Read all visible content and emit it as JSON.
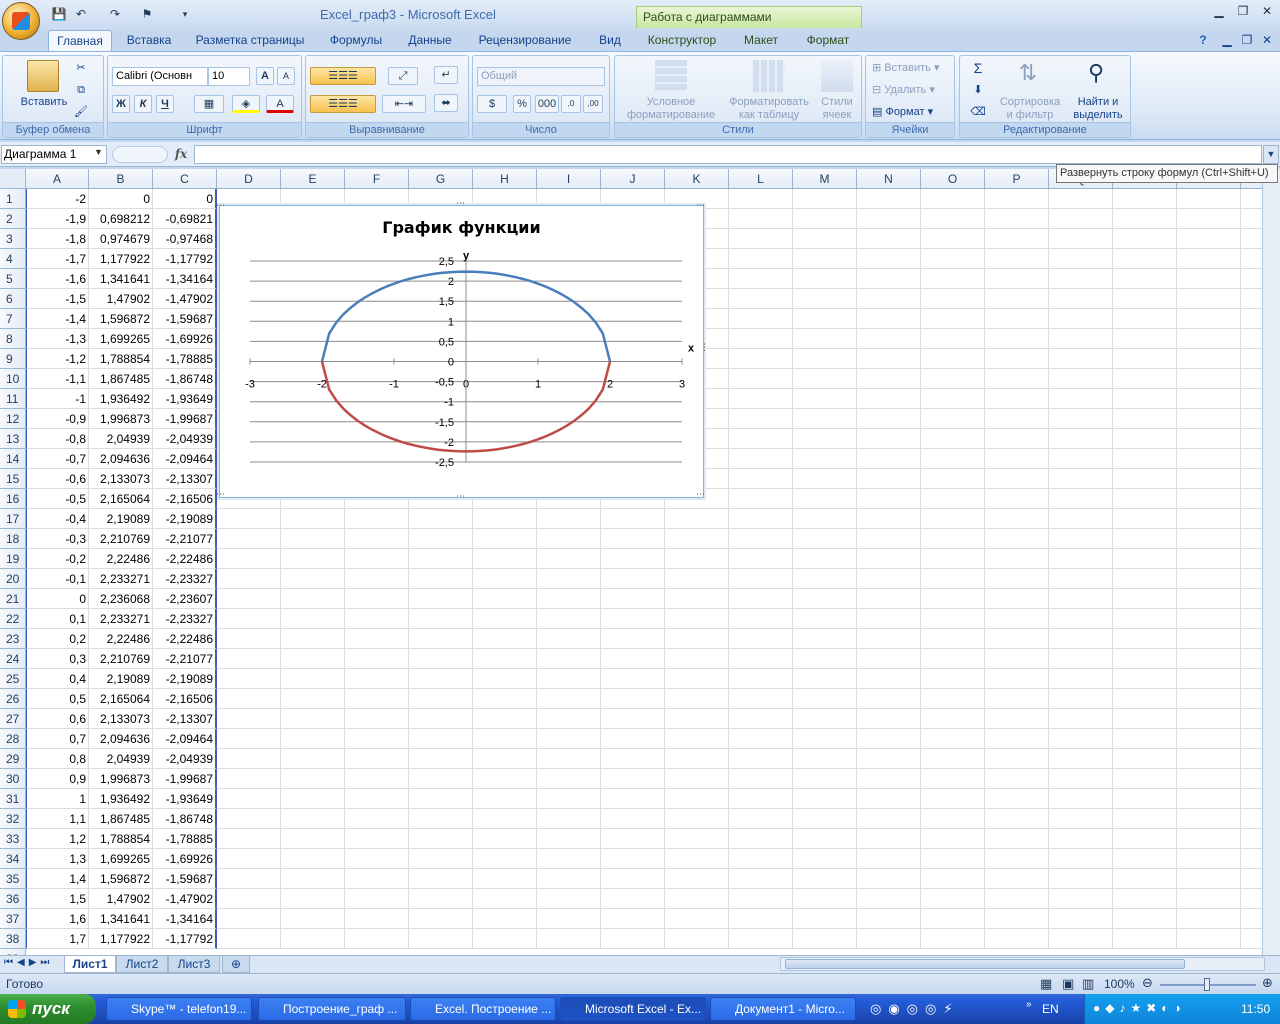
{
  "window": {
    "title": "Excel_граф3 - Microsoft Excel",
    "context_tools": "Работа с диаграммами"
  },
  "tabs": [
    {
      "label": "Главная",
      "active": true
    },
    {
      "label": "Вставка"
    },
    {
      "label": "Разметка страницы"
    },
    {
      "label": "Формулы"
    },
    {
      "label": "Данные"
    },
    {
      "label": "Рецензирование"
    },
    {
      "label": "Вид"
    },
    {
      "label": "Конструктор",
      "contextual": true
    },
    {
      "label": "Макет",
      "contextual": true
    },
    {
      "label": "Формат",
      "contextual": true
    }
  ],
  "ribbon": {
    "clipboard": {
      "label": "Буфер обмена",
      "paste": "Вставить"
    },
    "font": {
      "label": "Шрифт",
      "name": "Calibri (Основн",
      "size": "10",
      "bold": "Ж",
      "italic": "К",
      "underline": "Ч",
      "grow": "A",
      "shrink": "A"
    },
    "alignment": {
      "label": "Выравнивание"
    },
    "number": {
      "label": "Число",
      "format": "Общий"
    },
    "styles": {
      "label": "Стили",
      "cond1": "Условное",
      "cond2": "форматирование",
      "table1": "Форматировать",
      "table2": "как таблицу",
      "cell1": "Стили",
      "cell2": "ячеек"
    },
    "cells": {
      "label": "Ячейки",
      "insert": "Вставить",
      "delete": "Удалить",
      "format": "Формат"
    },
    "editing": {
      "label": "Редактирование",
      "sort1": "Сортировка",
      "sort2": "и фильтр",
      "find1": "Найти и",
      "find2": "выделить"
    }
  },
  "formula_bar": {
    "name_box": "Диаграмма 1",
    "fx": "fx",
    "value": "",
    "tooltip": "Развернуть строку формул (Ctrl+Shift+U)"
  },
  "columns": [
    "A",
    "B",
    "C",
    "D",
    "E",
    "F",
    "G",
    "H",
    "I",
    "J",
    "K",
    "L",
    "M",
    "N",
    "O",
    "P",
    "Q",
    "R",
    "S",
    "T"
  ],
  "rows": [
    [
      "-2",
      "0",
      "0"
    ],
    [
      "-1,9",
      "0,698212",
      "-0,69821"
    ],
    [
      "-1,8",
      "0,974679",
      "-0,97468"
    ],
    [
      "-1,7",
      "1,177922",
      "-1,17792"
    ],
    [
      "-1,6",
      "1,341641",
      "-1,34164"
    ],
    [
      "-1,5",
      "1,47902",
      "-1,47902"
    ],
    [
      "-1,4",
      "1,596872",
      "-1,59687"
    ],
    [
      "-1,3",
      "1,699265",
      "-1,69926"
    ],
    [
      "-1,2",
      "1,788854",
      "-1,78885"
    ],
    [
      "-1,1",
      "1,867485",
      "-1,86748"
    ],
    [
      "-1",
      "1,936492",
      "-1,93649"
    ],
    [
      "-0,9",
      "1,996873",
      "-1,99687"
    ],
    [
      "-0,8",
      "2,04939",
      "-2,04939"
    ],
    [
      "-0,7",
      "2,094636",
      "-2,09464"
    ],
    [
      "-0,6",
      "2,133073",
      "-2,13307"
    ],
    [
      "-0,5",
      "2,165064",
      "-2,16506"
    ],
    [
      "-0,4",
      "2,19089",
      "-2,19089"
    ],
    [
      "-0,3",
      "2,210769",
      "-2,21077"
    ],
    [
      "-0,2",
      "2,22486",
      "-2,22486"
    ],
    [
      "-0,1",
      "2,233271",
      "-2,23327"
    ],
    [
      "0",
      "2,236068",
      "-2,23607"
    ],
    [
      "0,1",
      "2,233271",
      "-2,23327"
    ],
    [
      "0,2",
      "2,22486",
      "-2,22486"
    ],
    [
      "0,3",
      "2,210769",
      "-2,21077"
    ],
    [
      "0,4",
      "2,19089",
      "-2,19089"
    ],
    [
      "0,5",
      "2,165064",
      "-2,16506"
    ],
    [
      "0,6",
      "2,133073",
      "-2,13307"
    ],
    [
      "0,7",
      "2,094636",
      "-2,09464"
    ],
    [
      "0,8",
      "2,04939",
      "-2,04939"
    ],
    [
      "0,9",
      "1,996873",
      "-1,99687"
    ],
    [
      "1",
      "1,936492",
      "-1,93649"
    ],
    [
      "1,1",
      "1,867485",
      "-1,86748"
    ],
    [
      "1,2",
      "1,788854",
      "-1,78885"
    ],
    [
      "1,3",
      "1,699265",
      "-1,69926"
    ],
    [
      "1,4",
      "1,596872",
      "-1,59687"
    ],
    [
      "1,5",
      "1,47902",
      "-1,47902"
    ],
    [
      "1,6",
      "1,341641",
      "-1,34164"
    ],
    [
      "1,7",
      "1,177922",
      "-1,17792"
    ]
  ],
  "chart_data": {
    "type": "line",
    "title": "График функции",
    "xlabel": "x",
    "ylabel": "y",
    "xlim": [
      -3,
      3
    ],
    "ylim": [
      -2.5,
      2.5
    ],
    "x_ticks": [
      "-3",
      "-2",
      "-1",
      "0",
      "1",
      "2",
      "3"
    ],
    "y_ticks": [
      "2,5",
      "2",
      "1,5",
      "1",
      "0,5",
      "0",
      "-0,5",
      "-1",
      "-1,5",
      "-2",
      "-2,5"
    ],
    "grid": true,
    "colors": [
      "#4a7ebb",
      "#be4b48"
    ],
    "x": [
      -2,
      -1.9,
      -1.8,
      -1.7,
      -1.6,
      -1.5,
      -1.4,
      -1.3,
      -1.2,
      -1.1,
      -1,
      -0.9,
      -0.8,
      -0.7,
      -0.6,
      -0.5,
      -0.4,
      -0.3,
      -0.2,
      -0.1,
      0,
      0.1,
      0.2,
      0.3,
      0.4,
      0.5,
      0.6,
      0.7,
      0.8,
      0.9,
      1,
      1.1,
      1.2,
      1.3,
      1.4,
      1.5,
      1.6,
      1.7,
      1.8,
      1.9,
      2
    ],
    "series": [
      {
        "values": [
          0,
          0.698212,
          0.974679,
          1.177922,
          1.341641,
          1.47902,
          1.596872,
          1.699265,
          1.788854,
          1.867485,
          1.936492,
          1.996873,
          2.04939,
          2.094636,
          2.133073,
          2.165064,
          2.19089,
          2.210769,
          2.22486,
          2.233271,
          2.236068,
          2.233271,
          2.22486,
          2.210769,
          2.19089,
          2.165064,
          2.133073,
          2.094636,
          2.04939,
          1.996873,
          1.936492,
          1.867485,
          1.788854,
          1.699265,
          1.596872,
          1.47902,
          1.341641,
          1.177922,
          0.974679,
          0.698212,
          0
        ]
      },
      {
        "values": [
          0,
          -0.698212,
          -0.974679,
          -1.177922,
          -1.341641,
          -1.47902,
          -1.596872,
          -1.699265,
          -1.788854,
          -1.867485,
          -1.936492,
          -1.996873,
          -2.04939,
          -2.094636,
          -2.133073,
          -2.165064,
          -2.19089,
          -2.210769,
          -2.22486,
          -2.233271,
          -2.236068,
          -2.233271,
          -2.22486,
          -2.210769,
          -2.19089,
          -2.165064,
          -2.133073,
          -2.094636,
          -2.04939,
          -1.996873,
          -1.936492,
          -1.867485,
          -1.788854,
          -1.699265,
          -1.596872,
          -1.47902,
          -1.341641,
          -1.177922,
          -0.974679,
          -0.698212,
          0
        ]
      }
    ]
  },
  "sheets": [
    {
      "label": "Лист1",
      "active": true
    },
    {
      "label": "Лист2"
    },
    {
      "label": "Лист3"
    }
  ],
  "status": {
    "ready": "Готово",
    "zoom": "100%"
  },
  "taskbar": {
    "start": "пуск",
    "tasks": [
      "Skype™ - telefon19...",
      "Построение_граф ...",
      "Excel. Построение ...",
      "Microsoft Excel - Ex...",
      "Документ1 - Micro..."
    ],
    "lang": "EN",
    "clock": "11:50"
  }
}
